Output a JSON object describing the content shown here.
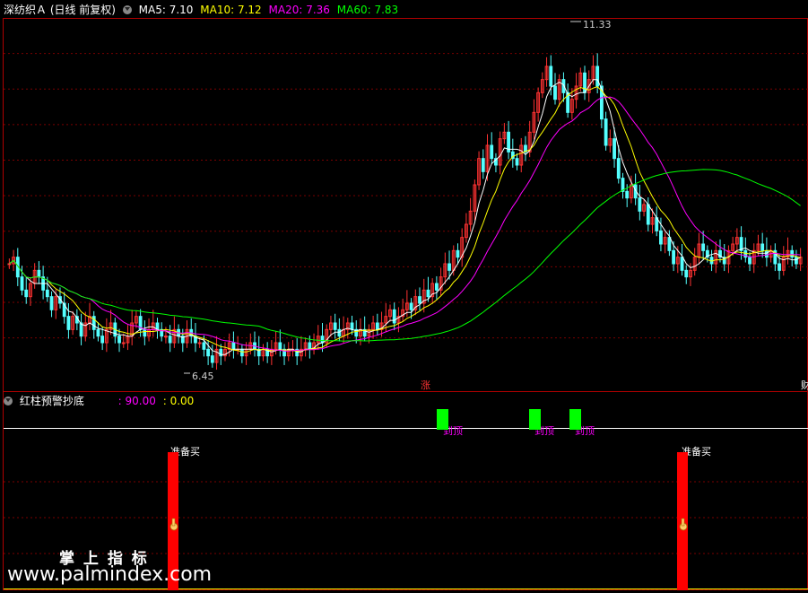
{
  "main_panel": {
    "stock_title": "深纺织Ａ (日线 前复权)",
    "indicators": [
      {
        "label": "MA5: 7.10",
        "color": "#ffffff"
      },
      {
        "label": "MA10: 7.12",
        "color": "#ffff00"
      },
      {
        "label": "MA20: 7.36",
        "color": "#ff00ff"
      },
      {
        "label": "MA60: 7.83",
        "color": "#00ff00"
      }
    ],
    "max_label": "11.33",
    "min_label": "6.45",
    "zhang_mark": "涨",
    "right_mark": "财"
  },
  "sub_panel": {
    "title": "红柱预警抄底",
    "value1": ": 90.00",
    "value2": ": 0.00",
    "value1_color": "#ff00ff",
    "value2_color": "#ffff00",
    "top_label": "到顶",
    "buy_label": "准备买"
  },
  "watermark": {
    "line1": "掌 上 指 标",
    "line2": "www.palmindex.com"
  },
  "colors": {
    "up": "#ff3232",
    "down": "#54ffff",
    "ma5": "#ffffff",
    "ma10": "#ffff00",
    "ma20": "#ff00ff",
    "ma60": "#00ff00",
    "frame": "#b00000",
    "grid": "#7a0000",
    "buy_bar": "#ff0000",
    "top_bar": "#00ff00"
  },
  "chart_data": [
    {
      "type": "candlestick",
      "title": "深纺织Ａ (日线 前复权)",
      "series": [
        {
          "name": "MA5",
          "last": 7.1
        },
        {
          "name": "MA10",
          "last": 7.12
        },
        {
          "name": "MA20",
          "last": 7.36
        },
        {
          "name": "MA60",
          "last": 7.83
        }
      ],
      "annotations": [
        {
          "text": "11.33",
          "kind": "highest"
        },
        {
          "text": "6.45",
          "kind": "lowest"
        }
      ],
      "close": [
        8.0,
        8.1,
        7.8,
        7.6,
        7.5,
        7.7,
        7.9,
        7.8,
        7.6,
        7.5,
        7.3,
        7.5,
        7.4,
        7.2,
        7.0,
        7.2,
        7.1,
        6.9,
        7.1,
        7.2,
        7.0,
        6.9,
        6.8,
        7.0,
        7.1,
        6.9,
        6.8,
        6.8,
        6.9,
        7.1,
        7.2,
        7.0,
        6.9,
        7.0,
        7.1,
        7.0,
        6.9,
        6.9,
        6.8,
        7.0,
        6.9,
        6.8,
        7.0,
        6.9,
        6.8,
        6.8,
        6.7,
        6.6,
        6.5,
        6.7,
        6.6,
        6.7,
        6.8,
        6.7,
        6.7,
        6.6,
        6.7,
        6.8,
        6.7,
        6.6,
        6.7,
        6.6,
        6.7,
        6.8,
        6.7,
        6.6,
        6.7,
        6.7,
        6.6,
        6.7,
        6.8,
        6.7,
        6.8,
        6.9,
        6.8,
        7.0,
        7.1,
        7.0,
        6.9,
        7.0,
        7.1,
        7.0,
        6.9,
        7.0,
        6.9,
        7.0,
        7.1,
        7.0,
        7.1,
        7.2,
        7.3,
        7.1,
        7.2,
        7.3,
        7.4,
        7.3,
        7.5,
        7.4,
        7.6,
        7.5,
        7.7,
        7.6,
        7.8,
        8.0,
        7.9,
        8.2,
        8.1,
        8.4,
        8.6,
        8.8,
        9.2,
        9.6,
        9.4,
        9.8,
        9.6,
        9.5,
        9.9,
        10.0,
        9.7,
        9.6,
        9.5,
        9.8,
        9.7,
        10.0,
        10.3,
        10.6,
        10.8,
        11.0,
        10.7,
        10.5,
        10.8,
        10.6,
        10.3,
        10.5,
        10.7,
        10.9,
        10.6,
        10.8,
        11.0,
        10.7,
        10.2,
        9.8,
        9.9,
        9.6,
        9.3,
        9.1,
        9.0,
        9.2,
        9.0,
        8.8,
        8.9,
        8.6,
        8.7,
        8.5,
        8.3,
        8.4,
        8.2,
        8.0,
        8.1,
        7.9,
        7.8,
        7.9,
        8.1,
        8.3,
        8.2,
        8.1,
        8.0,
        8.2,
        8.1,
        8.0,
        8.2,
        8.3,
        8.4,
        8.2,
        8.1,
        8.0,
        8.2,
        8.3,
        8.2,
        8.1,
        8.2,
        8.0,
        7.9,
        8.1,
        8.2,
        8.1,
        8.0,
        8.1
      ],
      "ylim": [
        6.2,
        11.6
      ]
    },
    {
      "type": "bar",
      "title": "红柱预警抄底",
      "series": [
        {
          "name": "准备买",
          "values": [
            90,
            90
          ]
        },
        {
          "name": "到顶",
          "values": [
            1,
            1,
            1
          ]
        }
      ],
      "ylim": [
        0,
        100
      ]
    }
  ]
}
